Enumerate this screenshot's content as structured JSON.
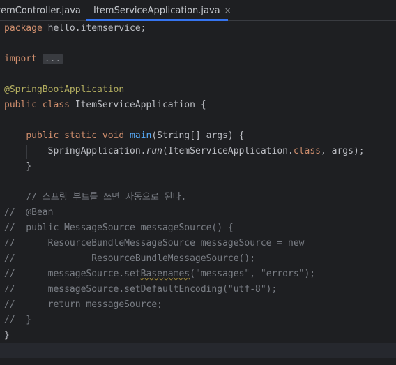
{
  "tabs": [
    {
      "label": "temController.java",
      "active": false
    },
    {
      "label": "ItemServiceApplication.java",
      "active": true,
      "icon": "spring-boot-class-icon",
      "close": "×"
    }
  ],
  "code": {
    "l1": {
      "kw": "package",
      "rest": " hello.itemservice;"
    },
    "l3": {
      "kw": "import",
      "fold": "..."
    },
    "l5": {
      "ann": "@SpringBootApplication"
    },
    "l6": {
      "kw": "public class",
      "rest": " ItemServiceApplication {"
    },
    "l8": {
      "kw": "public static void",
      "fn": "main",
      "rest": "(String[] args) {"
    },
    "l9": {
      "a": "SpringApplication.",
      "run": "run",
      "b": "(ItemServiceApplication.",
      "kw": "class",
      "c": ", args);"
    },
    "l10": {
      "text": "}"
    },
    "l12": {
      "text": "// 스프링 부트를 쓰면 자동으로 된다."
    },
    "l13": {
      "text": "//  @Bean"
    },
    "l14": {
      "text": "//  public MessageSource messageSource() {"
    },
    "l15": {
      "text": "//      ResourceBundleMessageSource messageSource = new"
    },
    "l16": {
      "text": "//              ResourceBundleMessageSource();"
    },
    "l17": {
      "a": "//      messageSource.set",
      "sq": "Basenames",
      "b": "(\"messages\", \"errors\");"
    },
    "l18": {
      "text": "//      messageSource.setDefaultEncoding(\"utf-8\");"
    },
    "l19": {
      "text": "//      return messageSource;"
    },
    "l20": {
      "text": "//  }"
    },
    "l21": {
      "text": "}"
    }
  },
  "colors": {
    "background": "#1e1f22",
    "keyword": "#cf8e6d",
    "annotation": "#b3ae60",
    "method": "#56a8f5",
    "comment": "#7a7e85",
    "accent": "#3574f0"
  }
}
